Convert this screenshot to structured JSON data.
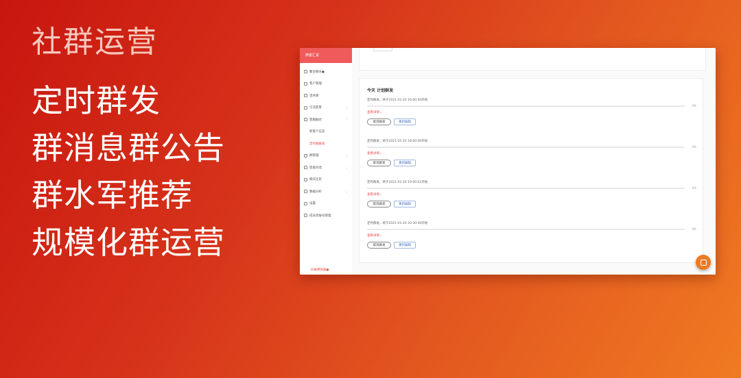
{
  "hero": {
    "title": "社群运营",
    "lines": [
      "定时群发",
      "群消息群公告",
      "群水军推荐",
      "规模化群运营"
    ]
  },
  "app": {
    "header": "微客汇说",
    "sidebar": {
      "items": [
        {
          "label": "聚合聊天●",
          "icon": "chat-icon"
        },
        {
          "label": "客户管理",
          "icon": "users-icon"
        },
        {
          "label": "话术库",
          "icon": "book-icon"
        },
        {
          "label": "引流获客",
          "icon": "person-icon",
          "chevron": "⌄"
        },
        {
          "label": "客服触达",
          "icon": "filter-icon",
          "chevron": "⌃"
        },
        {
          "label": "新客户应答",
          "sub": true
        },
        {
          "label": "定时群群发",
          "sub": true,
          "active": true
        },
        {
          "label": "群管理",
          "icon": "group-icon",
          "chevron": "⌄"
        },
        {
          "label": "智能对话",
          "icon": "bulb-icon",
          "chevron": "⌄"
        },
        {
          "label": "聊天历史",
          "icon": "clock-icon"
        },
        {
          "label": "数据分析",
          "icon": "chart-icon",
          "chevron": "⌄"
        },
        {
          "label": "设置",
          "icon": "gear-icon"
        },
        {
          "label": "成员及账号管理",
          "icon": "plus-icon"
        }
      ],
      "footer": "旧账模拟器●"
    },
    "panel": {
      "title": "今天  计划群发",
      "tasks": [
        {
          "desc": "定时群发，将于2021-01-20 16:00:00开始",
          "progress_percent": 0,
          "percent_label": "0%",
          "link": "查看详情⌄",
          "cancel": "取消群发",
          "edit": "重新编辑"
        },
        {
          "desc": "定时群发，将于2021-01-20 18:00:00开始",
          "progress_percent": 0,
          "percent_label": "0%",
          "link": "查看详情⌄",
          "cancel": "取消群发",
          "edit": "重新编辑"
        },
        {
          "desc": "定时群发，将于2021-01-20 19:00:01开始",
          "progress_percent": 0,
          "percent_label": "0%",
          "link": "查看详情⌄",
          "cancel": "取消群发",
          "edit": "重新编辑"
        },
        {
          "desc": "定时群发，将于2021-01-20 20:30:00开始",
          "progress_percent": 0,
          "percent_label": "0%",
          "link": "查看详情⌄",
          "cancel": "取消群发",
          "edit": "重新编辑"
        }
      ]
    },
    "colors": {
      "accent": "#e84d4d",
      "header": "#f05a5a",
      "fab": "#ee7a22"
    }
  }
}
